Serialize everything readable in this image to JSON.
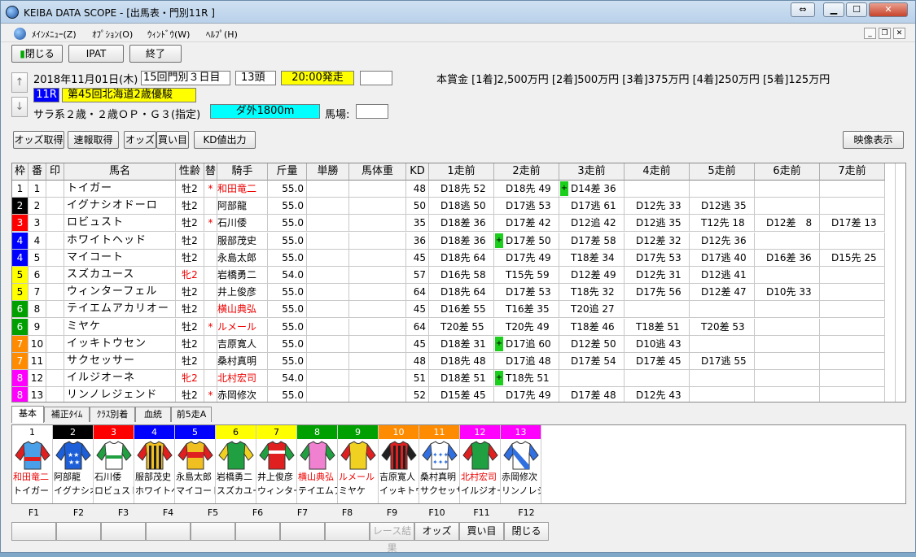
{
  "window": {
    "title": "KEIBA DATA SCOPE - [出馬表・門別11R ]"
  },
  "menu": [
    "ﾒｲﾝﾒﾆｭｰ(Z)",
    "ｵﾌﾟｼｮﾝ(O)",
    "ｳｨﾝﾄﾞｳ(W)",
    "ﾍﾙﾌﾟ(H)"
  ],
  "toolbar": {
    "close": "閉じる",
    "ipat": "IPAT",
    "end": "終了"
  },
  "race": {
    "date": "2018年11月01日(木)",
    "meeting": "15回門別３日目",
    "heads": "13頭",
    "post": "20:00発走",
    "num": "11R",
    "name": "第45回北海道2歳優駿",
    "cond": "サラ系２歳・２歳ＯＰ・Ｇ３(指定)",
    "course": "ダ外1800m",
    "baba_label": "馬場:",
    "prize": "本賞金 [1着]2,500万円 [2着]500万円 [3着]375万円 [4着]250万円 [5着]125万円"
  },
  "buttons": {
    "odds_get": "オッズ取得",
    "sokuho": "速報取得",
    "odds": "オッズ",
    "kaime": "買い目",
    "kd": "KD値出力",
    "video": "映像表示"
  },
  "headers": [
    "枠",
    "番",
    "印",
    "馬名",
    "性齢",
    "替",
    "騎手",
    "斤量",
    "単勝",
    "馬体重",
    "KD",
    "1走前",
    "2走前",
    "3走前",
    "4走前",
    "5走前",
    "6走前",
    "7走前"
  ],
  "colors": {
    "frame1": "#ffffff",
    "frame2": "#000000",
    "frame3": "#ff0000",
    "frame4": "#0000ff",
    "frame5": "#ffff00",
    "frame6": "#00a000",
    "frame7": "#ff8c00",
    "frame8": "#ff00ff"
  },
  "rows": [
    {
      "waku": "1",
      "ban": "1",
      "name": "トイガー",
      "sex": "牡2",
      "sexred": false,
      "kae": "*",
      "jockey": "和田竜二",
      "jred": true,
      "kin": "55.0",
      "kd": "48",
      "r": [
        "D18先 52",
        "D18先 49",
        "D14差 36",
        "",
        "",
        "",
        ""
      ],
      "p": [
        false,
        true
      ]
    },
    {
      "waku": "2",
      "ban": "2",
      "name": "イグナシオドーロ",
      "sex": "牡2",
      "sexred": false,
      "kae": "",
      "jockey": "阿部龍",
      "jred": false,
      "kin": "55.0",
      "kd": "50",
      "r": [
        "D18逃 50",
        "D17逃 53",
        "D17逃 61",
        "D12先 33",
        "D12逃 35",
        "",
        ""
      ],
      "p": [
        false,
        false
      ]
    },
    {
      "waku": "3",
      "ban": "3",
      "name": "ロビュスト",
      "sex": "牡2",
      "sexred": false,
      "kae": "*",
      "jockey": "石川倭",
      "jred": false,
      "kin": "55.0",
      "kd": "35",
      "r": [
        "D18差 36",
        "D17差 42",
        "D12追 42",
        "D12逃 35",
        "T12先 18",
        "D12差　8",
        "D17差 13"
      ],
      "p": [
        false,
        false
      ]
    },
    {
      "waku": "4",
      "ban": "4",
      "name": "ホワイトヘッド",
      "sex": "牡2",
      "sexred": false,
      "kae": "",
      "jockey": "服部茂史",
      "jred": false,
      "kin": "55.0",
      "kd": "36",
      "r": [
        "D18差 36",
        "D17差 50",
        "D17差 58",
        "D12差 32",
        "D12先 36",
        "",
        ""
      ],
      "p": [
        true,
        false
      ]
    },
    {
      "waku": "4",
      "ban": "5",
      "name": "マイコート",
      "sex": "牡2",
      "sexred": false,
      "kae": "",
      "jockey": "永島太郎",
      "jred": false,
      "kin": "55.0",
      "kd": "45",
      "r": [
        "D18先 64",
        "D17先 49",
        "T18差 34",
        "D17先 53",
        "D17逃 40",
        "D16差 36",
        "D15先 25"
      ],
      "p": [
        false,
        false
      ]
    },
    {
      "waku": "5",
      "ban": "6",
      "name": "スズカユース",
      "sex": "牝2",
      "sexred": true,
      "kae": "",
      "jockey": "岩橋勇二",
      "jred": false,
      "kin": "54.0",
      "kd": "57",
      "r": [
        "D16先 58",
        "T15先 59",
        "D12差 49",
        "D12先 31",
        "D12逃 41",
        "",
        ""
      ],
      "p": [
        false,
        false
      ]
    },
    {
      "waku": "5",
      "ban": "7",
      "name": "ウィンターフェル",
      "sex": "牡2",
      "sexred": false,
      "kae": "",
      "jockey": "井上俊彦",
      "jred": false,
      "kin": "55.0",
      "kd": "64",
      "r": [
        "D18先 64",
        "D17差 53",
        "T18先 32",
        "D17先 56",
        "D12差 47",
        "D10先 33",
        ""
      ],
      "p": [
        false,
        false
      ]
    },
    {
      "waku": "6",
      "ban": "8",
      "name": "テイエムアカリオー",
      "sex": "牡2",
      "sexred": false,
      "kae": "",
      "jockey": "横山典弘",
      "jred": true,
      "kin": "55.0",
      "kd": "45",
      "r": [
        "D16差 55",
        "T16差 35",
        "T20追 27",
        "",
        "",
        "",
        ""
      ],
      "p": [
        false,
        false
      ]
    },
    {
      "waku": "6",
      "ban": "9",
      "name": "ミヤケ",
      "sex": "牡2",
      "sexred": false,
      "kae": "*",
      "jockey": "ルメール",
      "jred": true,
      "kin": "55.0",
      "kd": "64",
      "r": [
        "T20差 55",
        "T20先 49",
        "T18差 46",
        "T18差 51",
        "T20差 53",
        "",
        ""
      ],
      "p": [
        false,
        false
      ]
    },
    {
      "waku": "7",
      "ban": "10",
      "name": "イッキトウセン",
      "sex": "牡2",
      "sexred": false,
      "kae": "",
      "jockey": "吉原寛人",
      "jred": false,
      "kin": "55.0",
      "kd": "45",
      "r": [
        "D18差 31",
        "D17追 60",
        "D12差 50",
        "D10逃 43",
        "",
        "",
        ""
      ],
      "p": [
        true,
        false
      ]
    },
    {
      "waku": "7",
      "ban": "11",
      "name": "サクセッサー",
      "sex": "牡2",
      "sexred": false,
      "kae": "",
      "jockey": "桑村真明",
      "jred": false,
      "kin": "55.0",
      "kd": "48",
      "r": [
        "D18先 48",
        "D17追 48",
        "D17差 54",
        "D17差 45",
        "D17逃 55",
        "",
        ""
      ],
      "p": [
        false,
        false
      ]
    },
    {
      "waku": "8",
      "ban": "12",
      "name": "イルジオーネ",
      "sex": "牝2",
      "sexred": true,
      "kae": "",
      "jockey": "北村宏司",
      "jred": true,
      "kin": "54.0",
      "kd": "51",
      "r": [
        "D18差 51",
        "T18先 51",
        "",
        "",
        "",
        "",
        ""
      ],
      "p": [
        true,
        false
      ]
    },
    {
      "waku": "8",
      "ban": "13",
      "name": "リンノレジェンド",
      "sex": "牡2",
      "sexred": false,
      "kae": "*",
      "jockey": "赤岡修次",
      "jred": false,
      "kin": "55.0",
      "kd": "52",
      "r": [
        "D15差 45",
        "D17先 49",
        "D17差 48",
        "D12先 43",
        "",
        "",
        ""
      ],
      "p": [
        false,
        false
      ]
    }
  ],
  "tabs": [
    "基本",
    "補正ﾀｲﾑ",
    "ｸﾗｽ別着",
    "血統",
    "前5走A"
  ],
  "jockeys": [
    {
      "num": "1",
      "jockey": "和田竜二",
      "horse": "トイガー",
      "jred": true
    },
    {
      "num": "2",
      "jockey": "阿部龍",
      "horse": "イグナシオ",
      "jred": false
    },
    {
      "num": "3",
      "jockey": "石川倭",
      "horse": "ロビュスト",
      "jred": false
    },
    {
      "num": "4",
      "jockey": "服部茂史",
      "horse": "ホワイトヘ",
      "jred": false
    },
    {
      "num": "5",
      "jockey": "永島太郎",
      "horse": "マイコート",
      "jred": false
    },
    {
      "num": "6",
      "jockey": "岩橋勇二",
      "horse": "スズカユー",
      "jred": false
    },
    {
      "num": "7",
      "jockey": "井上俊彦",
      "horse": "ウィンター",
      "jred": false
    },
    {
      "num": "8",
      "jockey": "横山典弘",
      "horse": "テイエムア",
      "jred": true
    },
    {
      "num": "9",
      "jockey": "ルメール",
      "horse": "ミヤケ",
      "jred": true
    },
    {
      "num": "10",
      "jockey": "吉原寛人",
      "horse": "イッキトウ",
      "jred": false
    },
    {
      "num": "11",
      "jockey": "桑村真明",
      "horse": "サクセッサ",
      "jred": false
    },
    {
      "num": "12",
      "jockey": "北村宏司",
      "horse": "イルジオー",
      "jred": true
    },
    {
      "num": "13",
      "jockey": "赤岡修次",
      "horse": "リンノレジ",
      "jred": false
    }
  ],
  "fkeys": [
    "F1",
    "F2",
    "F3",
    "F4",
    "F5",
    "F6",
    "F7",
    "F8",
    "F9",
    "F10",
    "F11",
    "F12"
  ],
  "fbuttons": [
    "",
    "",
    "",
    "",
    "",
    "",
    "",
    "",
    "レース結果",
    "オッズ",
    "買い目",
    "閉じる"
  ]
}
